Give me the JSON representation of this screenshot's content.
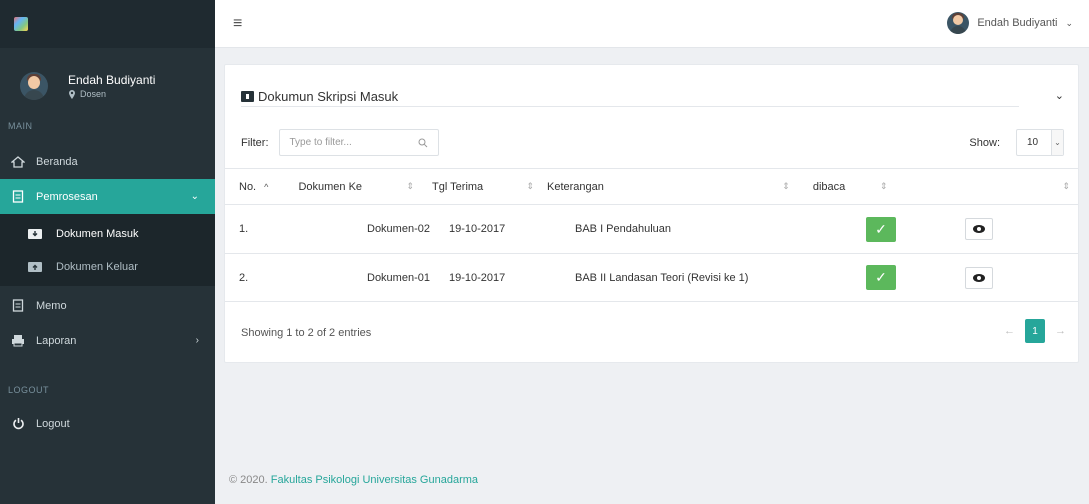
{
  "sidebar": {
    "user": {
      "name": "Endah Budiyanti",
      "role": "Dosen"
    },
    "section_main": "MAIN",
    "items": [
      {
        "label": "Beranda"
      },
      {
        "label": "Pemrosesan"
      },
      {
        "label": "Dokumen Masuk"
      },
      {
        "label": "Dokumen Keluar"
      },
      {
        "label": "Memo"
      },
      {
        "label": "Laporan"
      }
    ],
    "section_logout": "LOGOUT",
    "logout_label": "Logout"
  },
  "topbar": {
    "user_name": "Endah Budiyanti"
  },
  "panel": {
    "title": "Dokumun Skripsi Masuk",
    "filter_label": "Filter:",
    "filter_placeholder": "Type to filter...",
    "show_label": "Show:",
    "show_value": "10",
    "columns": [
      "No.",
      "Dokumen Ke",
      "Tgl Terima",
      "Keterangan",
      "dibaca"
    ],
    "rows": [
      {
        "no": "1.",
        "dokumen": "Dokumen-02",
        "tgl": "19-10-2017",
        "keterangan": "BAB I Pendahuluan"
      },
      {
        "no": "2.",
        "dokumen": "Dokumen-01",
        "tgl": "19-10-2017",
        "keterangan": "BAB II Landasan Teori (Revisi ke 1)"
      }
    ],
    "info": "Showing 1 to 2 of 2 entries",
    "page": "1"
  },
  "footer": {
    "copyright": "© 2020.",
    "org": "Fakultas Psikologi Universitas Gunadarma"
  },
  "colors": {
    "sidebar": "#263238",
    "accent": "#26a69a",
    "success": "#5cb85c"
  }
}
